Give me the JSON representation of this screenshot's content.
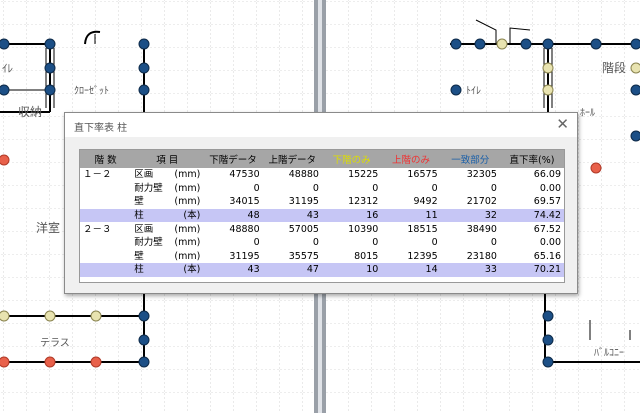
{
  "background": {
    "labels": {
      "toilet_left": "ｲﾚ",
      "closet": "ｸﾛｰｾﾞｯﾄ",
      "storage": "収納",
      "western": "洋室",
      "terrace": "テラス",
      "toilet_right": "ﾄｲﾚ",
      "stairs": "階段",
      "hall": "ﾎｰﾙ",
      "balcony": "ﾊﾞﾙｺﾆｰ"
    }
  },
  "dialog": {
    "title": "直下率表  柱",
    "close_symbol": "✕",
    "colors": {
      "upper_only": "#ee3333",
      "lower_only": "#dddd00",
      "match": "#1a5fa8"
    },
    "headers": [
      "階 数",
      "項 目",
      "下階データ",
      "上階データ",
      "下階のみ",
      "上階のみ",
      "一致部分",
      "直下率(%)"
    ],
    "rows": [
      {
        "floor": "１－２",
        "item": "区画",
        "unit": "(mm)",
        "values": [
          "47530",
          "48880",
          "15225",
          "16575",
          "32305",
          "66.09"
        ],
        "pillar": false
      },
      {
        "floor": "",
        "item": "耐力壁",
        "unit": "(mm)",
        "values": [
          "0",
          "0",
          "0",
          "0",
          "0",
          "0.00"
        ],
        "pillar": false
      },
      {
        "floor": "",
        "item": "壁",
        "unit": "(mm)",
        "values": [
          "34015",
          "31195",
          "12312",
          "9492",
          "21702",
          "69.57"
        ],
        "pillar": false
      },
      {
        "floor": "",
        "item": "柱",
        "unit": "(本)",
        "values": [
          "48",
          "43",
          "16",
          "11",
          "32",
          "74.42"
        ],
        "pillar": true
      },
      {
        "floor": "２－３",
        "item": "区画",
        "unit": "(mm)",
        "values": [
          "48880",
          "57005",
          "10390",
          "18515",
          "38490",
          "67.52"
        ],
        "pillar": false
      },
      {
        "floor": "",
        "item": "耐力壁",
        "unit": "(mm)",
        "values": [
          "0",
          "0",
          "0",
          "0",
          "0",
          "0.00"
        ],
        "pillar": false
      },
      {
        "floor": "",
        "item": "壁",
        "unit": "(mm)",
        "values": [
          "31195",
          "35575",
          "8015",
          "12395",
          "23180",
          "65.16"
        ],
        "pillar": false
      },
      {
        "floor": "",
        "item": "柱",
        "unit": "(本)",
        "values": [
          "43",
          "47",
          "10",
          "14",
          "33",
          "70.21"
        ],
        "pillar": true
      }
    ]
  }
}
